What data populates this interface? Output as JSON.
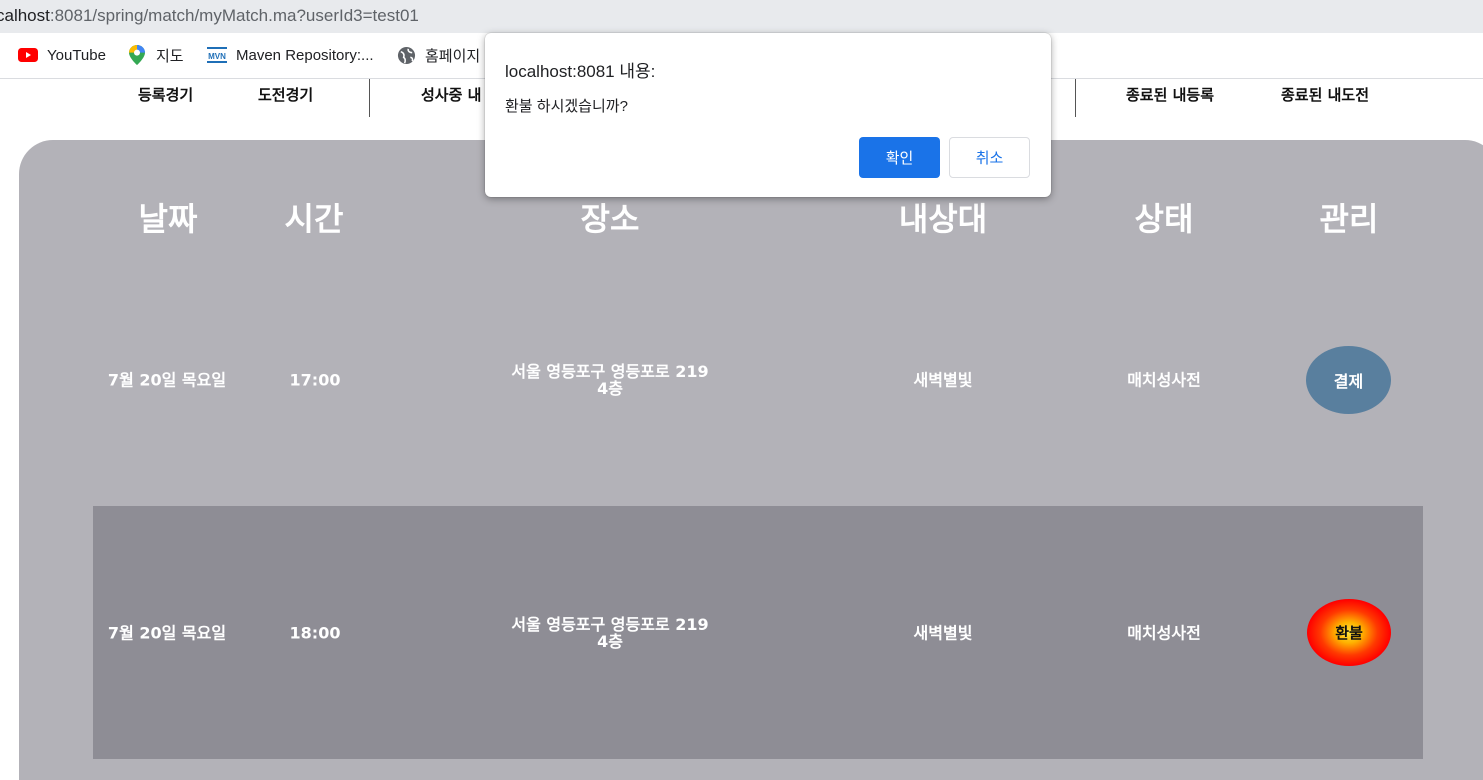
{
  "browser": {
    "url_host": "calhost",
    "url_rest": ":8081/spring/match/myMatch.ma?userId3=test01"
  },
  "bookmarks": [
    {
      "label": "YouTube",
      "icon": "youtube-icon"
    },
    {
      "label": "지도",
      "icon": "maps-pin-icon"
    },
    {
      "label": "Maven Repository:...",
      "icon": "mvn-icon"
    },
    {
      "label": "홈페이지",
      "icon": "globe-icon"
    }
  ],
  "subnav": {
    "items": [
      "등록경기",
      "도전경기",
      "성사중 내",
      "종료된 내등록",
      "종료된 내도전"
    ]
  },
  "table": {
    "headers": [
      "날짜",
      "시간",
      "장소",
      "내상대",
      "상태",
      "관리"
    ],
    "rows": [
      {
        "date": "7월 20일 목요일",
        "time": "17:00",
        "place_line1": "서울 영등포구 영등포로 219",
        "place_line2": "4층",
        "opponent": "새벽별빛",
        "status": "매치성사전",
        "action": "결제"
      },
      {
        "date": "7월 20일 목요일",
        "time": "18:00",
        "place_line1": "서울 영등포구 영등포로 219",
        "place_line2": "4층",
        "opponent": "새벽별빛",
        "status": "매치성사전",
        "action": "환불"
      }
    ]
  },
  "dialog": {
    "title": "localhost:8081 내용:",
    "message": "환불 하시겠습니까?",
    "ok_label": "확인",
    "cancel_label": "취소"
  },
  "colors": {
    "panel": "#b3b2b8",
    "row_highlight": "#8e8d95",
    "pay_button": "#597f9e",
    "refund_button": "#ff0000",
    "dialog_primary": "#1a73e8"
  }
}
